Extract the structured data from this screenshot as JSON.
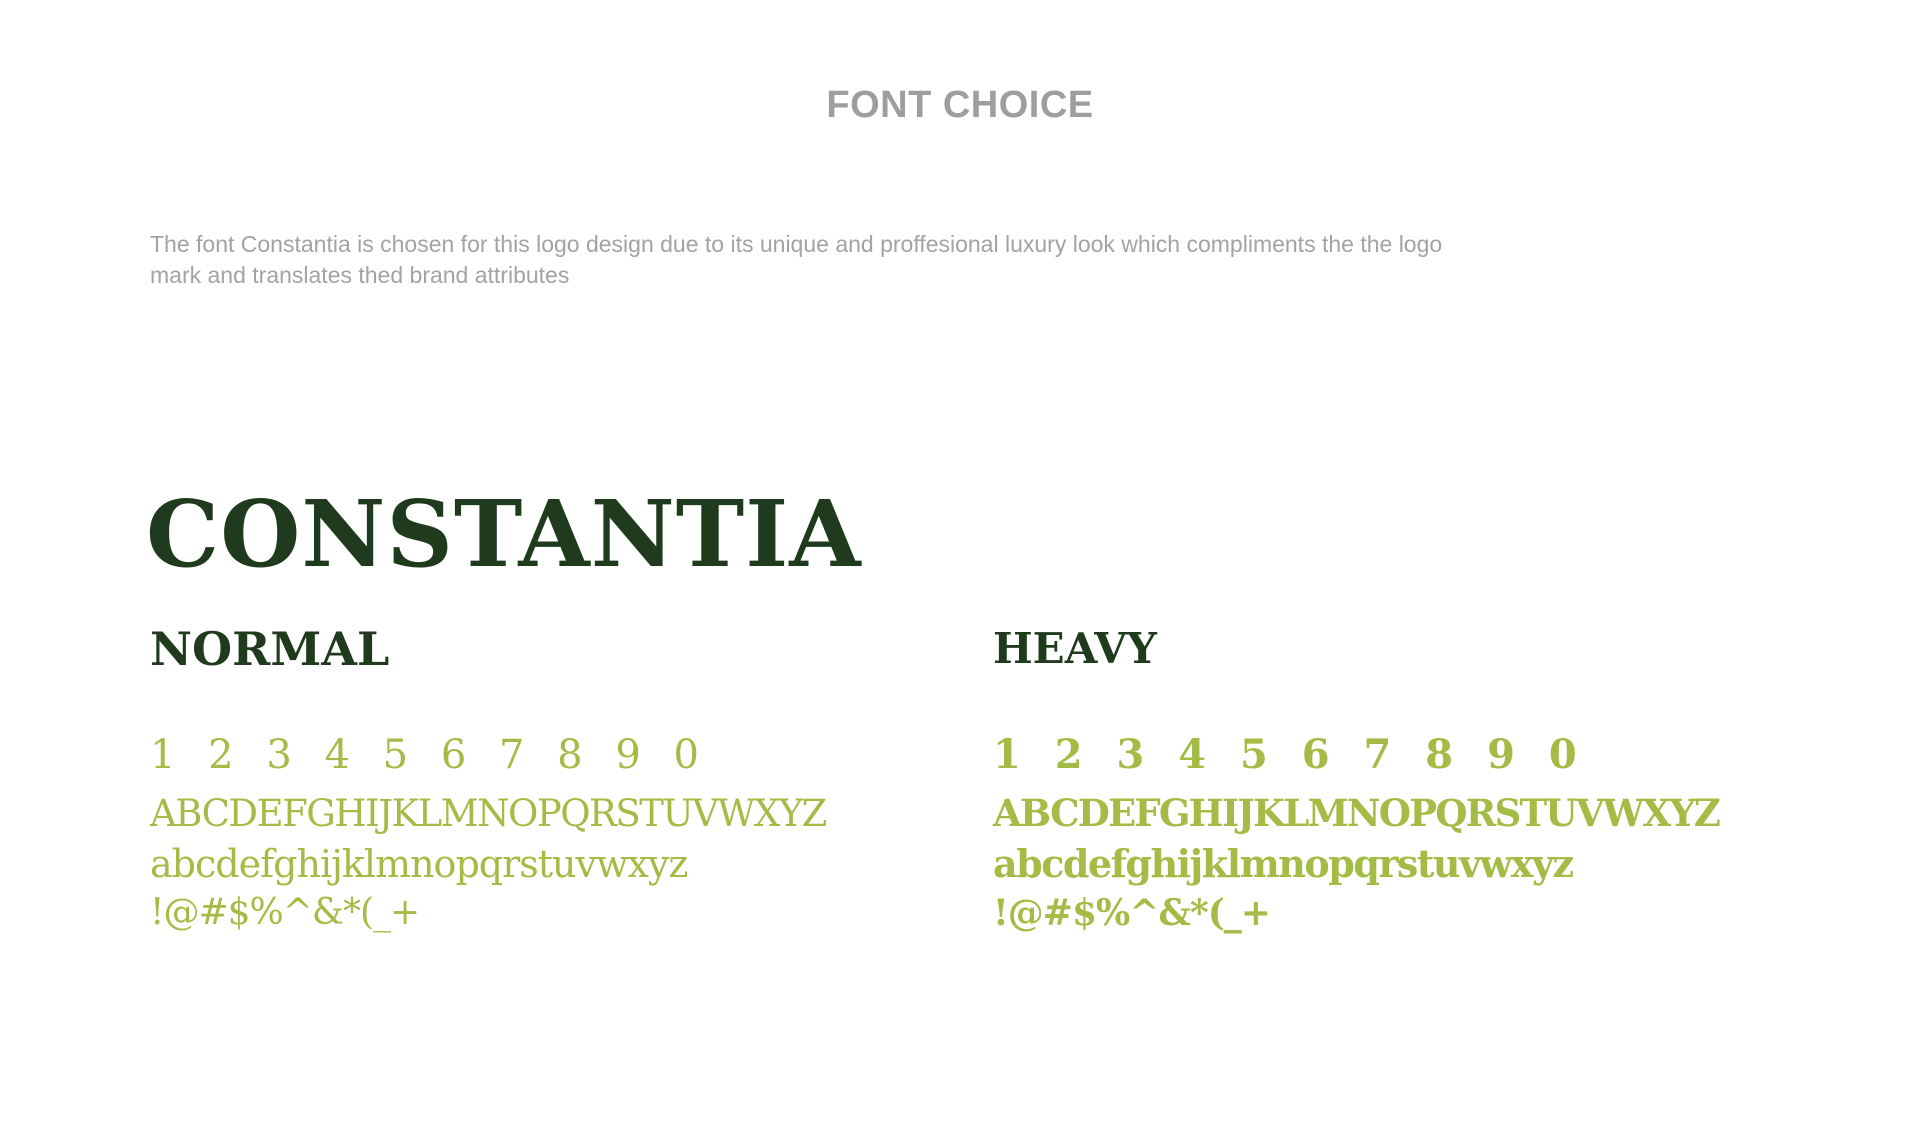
{
  "page": {
    "title": "FONT CHOICE",
    "description": "The font Constantia is chosen for this logo design due to its unique and proffesional luxury look which compliments the the logo mark and translates thed brand attributes"
  },
  "font": {
    "name": "CONSTANTIA",
    "colors": {
      "heading": "#1f3a1c",
      "sample": "#a4bb45",
      "muted_text": "#9e9e9e"
    }
  },
  "variants": [
    {
      "label": "NORMAL",
      "digits": "1 2 3 4 5 6 7 8 9 0",
      "uppercase": "ABCDEFGHIJKLMNOPQRSTUVWXYZ",
      "lowercase": "abcdefghijklmnopqrstuvwxyz",
      "symbols": "!@#$%^&*(_+"
    },
    {
      "label": "HEAVY",
      "digits": "1 2 3 4 5 6 7 8 9 0",
      "uppercase": "ABCDEFGHIJKLMNOPQRSTUVWXYZ",
      "lowercase": "abcdefghijklmnopqrstuvwxyz",
      "symbols": "!@#$%^&*(_+"
    }
  ]
}
